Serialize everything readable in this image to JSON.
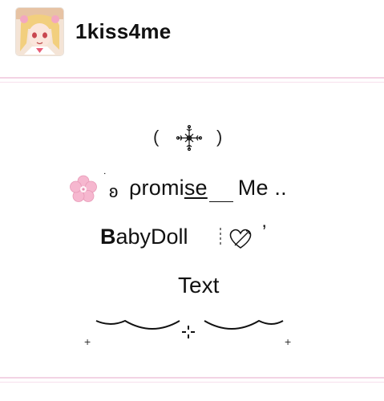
{
  "header": {
    "username": "1kiss4me",
    "avatar": "anime-girl-avatar"
  },
  "post": {
    "line1": {
      "open": "(",
      "close": ")",
      "icon": "ornate-cross-icon"
    },
    "line2": {
      "flower_icon": "pink-flower-icon",
      "dot": "˙",
      "ear": "ʚ",
      "word_prefix": "ρromi",
      "word_underlined": "se",
      "word_suffix": "Me .."
    },
    "line3": {
      "first_letter": "B",
      "rest": "abyDoll",
      "heart_icon": "heart-with-arrow-icon",
      "apostrophe": "’"
    },
    "line4": {
      "text": "Text"
    },
    "line5": {
      "left_plus": "+",
      "right_plus": "+",
      "sparkle": "sparkle-icon"
    }
  },
  "colors": {
    "divider": "#f3d3e4",
    "flower": "#f6b7cf",
    "text": "#111111"
  }
}
